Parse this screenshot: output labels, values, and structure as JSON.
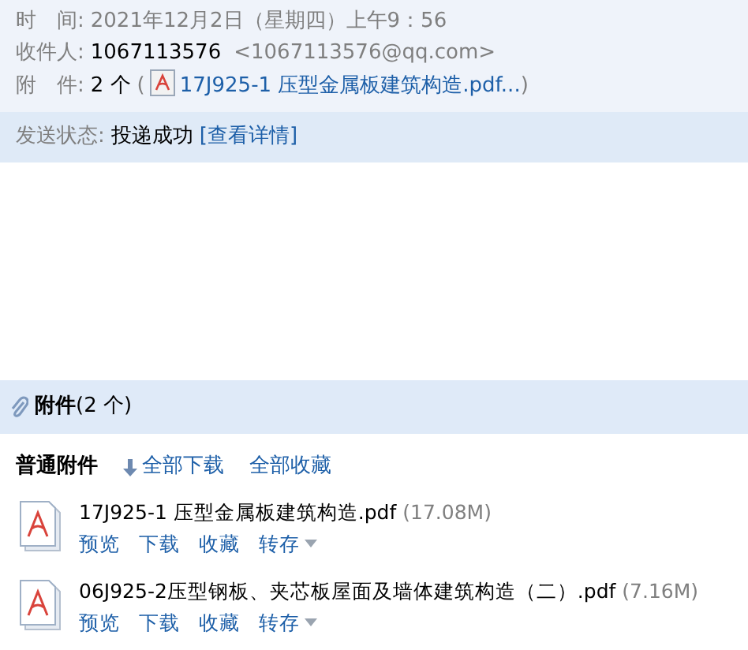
{
  "meta": {
    "time": {
      "label": "时　间:",
      "value": "2021年12月2日（星期四）上午9：56"
    },
    "recipient": {
      "label": "收件人:",
      "name": "1067113576",
      "address": "<1067113576@qq.com>"
    },
    "attachment": {
      "label": "附　件:",
      "count": "2 个",
      "open": "(",
      "file": "17J925-1 压型金属板建筑构造.pdf...",
      "close": ")"
    }
  },
  "status": {
    "label": "发送状态:",
    "value": "投递成功",
    "link": "[查看详情]"
  },
  "attachments_header": {
    "title": "附件",
    "count": "(2 个)"
  },
  "toolbar": {
    "label": "普通附件",
    "download_all": "全部下载",
    "save_all": "全部收藏"
  },
  "files": [
    {
      "name": "17J925-1 压型金属板建筑构造.pdf",
      "size": "(17.08M)",
      "actions": [
        {
          "label": "预览",
          "kind": "link"
        },
        {
          "label": "下载",
          "kind": "link"
        },
        {
          "label": "收藏",
          "kind": "link"
        },
        {
          "label": "转存",
          "kind": "menu"
        }
      ]
    },
    {
      "name": "06J925-2压型钢板、夹芯板屋面及墙体建筑构造（二）.pdf",
      "size": "(7.16M)",
      "actions": [
        {
          "label": "预览",
          "kind": "link"
        },
        {
          "label": "下载",
          "kind": "link"
        },
        {
          "label": "收藏",
          "kind": "link"
        },
        {
          "label": "转存",
          "kind": "menu"
        }
      ]
    }
  ]
}
